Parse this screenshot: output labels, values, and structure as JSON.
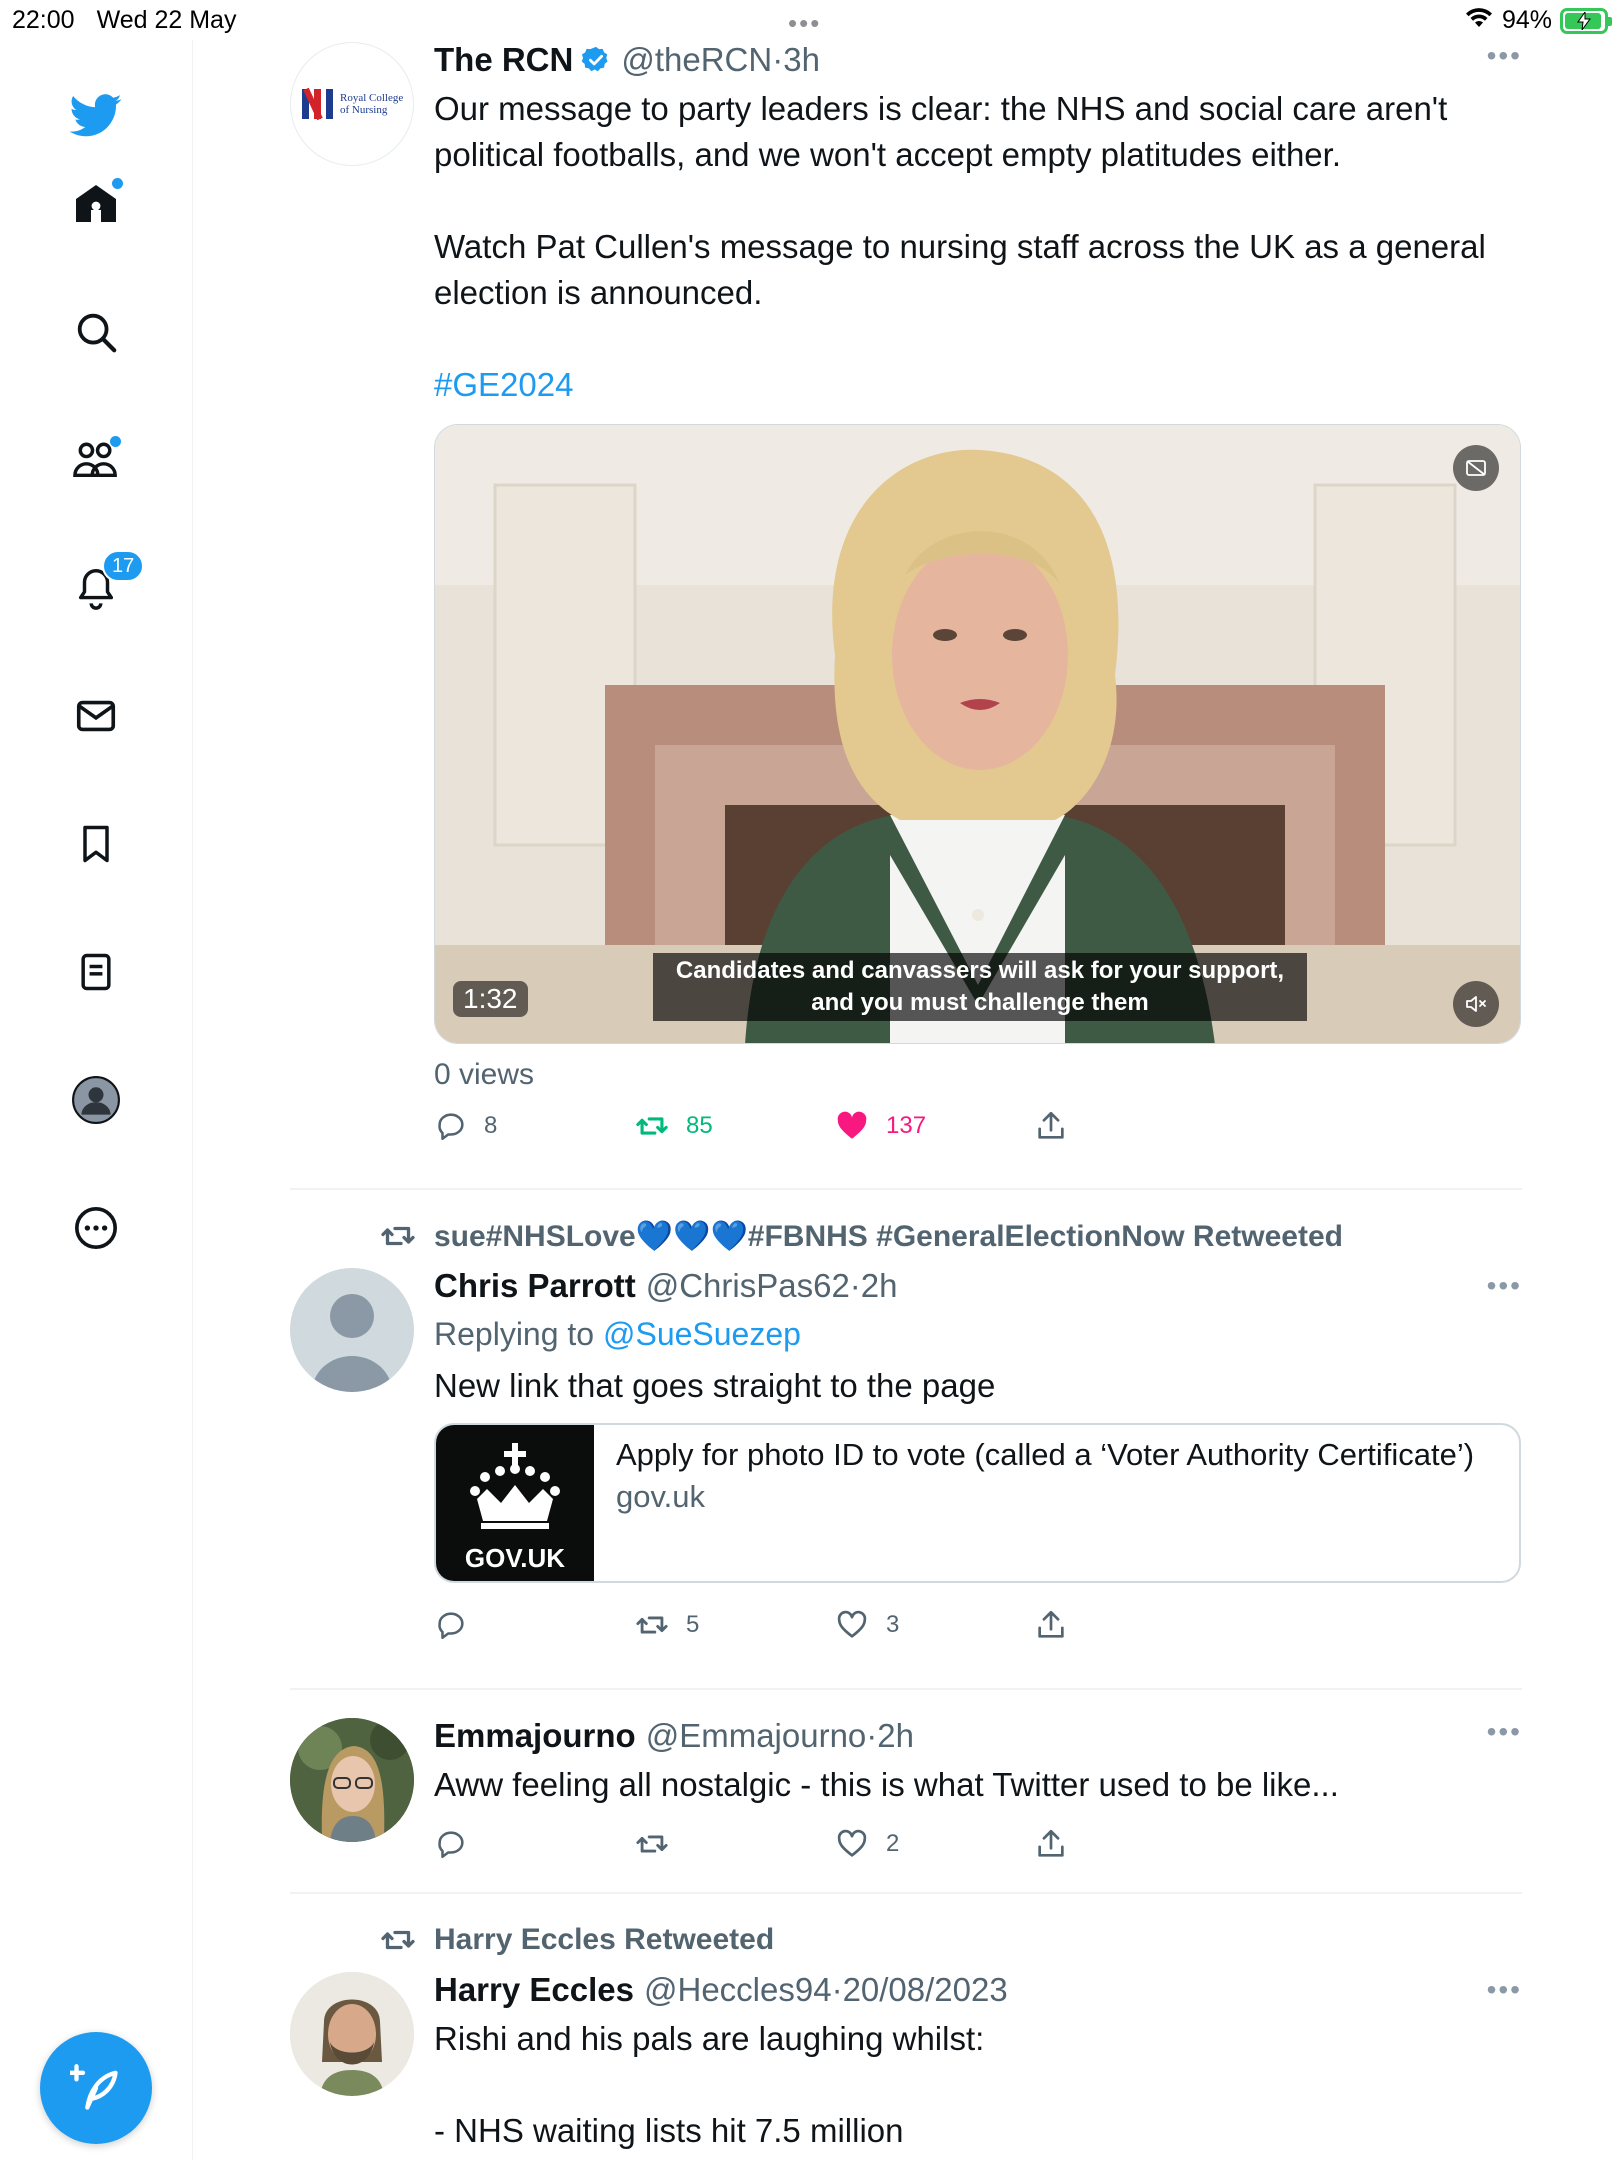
{
  "status_bar": {
    "time": "22:00",
    "date": "Wed 22 May",
    "battery": "94%"
  },
  "sidebar": {
    "items": [
      {
        "name": "home"
      },
      {
        "name": "search"
      },
      {
        "name": "communities"
      },
      {
        "name": "notifications",
        "badge": "17"
      },
      {
        "name": "messages"
      },
      {
        "name": "bookmarks"
      },
      {
        "name": "lists"
      },
      {
        "name": "profile"
      },
      {
        "name": "more"
      }
    ]
  },
  "tweets": [
    {
      "name": "The RCN",
      "handle": "@theRCN",
      "time": "3h",
      "verified": true,
      "avatar_text": "Royal College of Nursing",
      "text1": "Our message to party leaders is clear: the NHS and social care aren't political footballs, and we won't accept empty platitudes either.",
      "text2": "Watch Pat Cullen's message to nursing staff across the UK as a general election is announced.",
      "hashtag": "#GE2024",
      "video": {
        "duration": "1:32",
        "caption_line1": "Candidates and canvassers will ask for your support,",
        "caption_line2": "and you must challenge them"
      },
      "views": "0 views",
      "replies": "8",
      "retweets": "85",
      "likes": "137"
    },
    {
      "retweeted_by": "sue#NHSLove💙💙💙#FBNHS #GeneralElectionNow Retweeted",
      "name": "Chris Parrott",
      "handle": "@ChrisPas62",
      "time": "2h",
      "replying_prefix": "Replying to",
      "replying_to": "@SueSuezep",
      "text": "New link that goes straight to the page",
      "card": {
        "title": "Apply for photo ID to vote (called a ‘Voter Authority Certificate’)",
        "domain": "gov.uk",
        "thumb_label": "GOV.UK"
      },
      "replies": "",
      "retweets": "5",
      "likes": "3"
    },
    {
      "name": "Emmajourno",
      "handle": "@Emmajourno",
      "time": "2h",
      "text": "Aww feeling all nostalgic - this is what Twitter used to be like...",
      "replies": "",
      "retweets": "",
      "likes": "2"
    },
    {
      "retweeted_by": "Harry Eccles Retweeted",
      "name": "Harry Eccles",
      "handle": "@Heccles94",
      "time": "20/08/2023",
      "text1": "Rishi and his pals are laughing whilst:",
      "text2": "- NHS waiting lists hit 7.5 million"
    }
  ],
  "colors": {
    "accent": "#1d9bf0",
    "retweet": "#00ba7c",
    "like": "#f91880",
    "secondary_text": "#536471"
  }
}
